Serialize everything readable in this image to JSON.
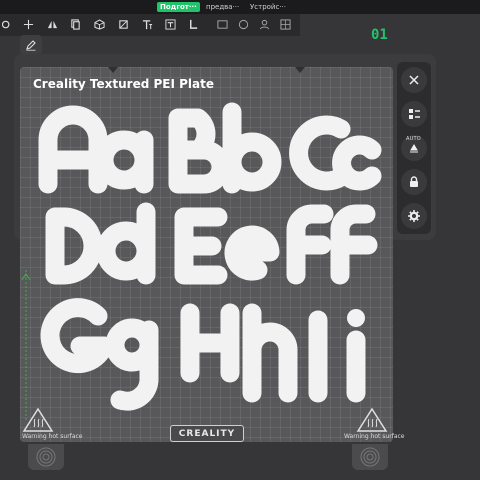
{
  "tabs": [
    {
      "label": "Подгот···",
      "active": true
    },
    {
      "label": "предва···",
      "active": false
    },
    {
      "label": "Устройс···",
      "active": false
    }
  ],
  "toolbar": {
    "icons": [
      "partial-icon",
      "move-icon",
      "mirror-icon",
      "copy-icon",
      "cube-icon",
      "box-icon",
      "text-icon",
      "text-plus-icon",
      "corner-icon",
      "corner-cut-icon",
      "image-icon",
      "sphere-icon",
      "user-icon",
      "grid-icon"
    ]
  },
  "counter": "01",
  "plate": {
    "title": "Creality Textured PEI Plate",
    "logo": "CREALITY",
    "warning": "Warning hot surface"
  },
  "sidebar": {
    "auto_label": "AUTO",
    "icons": [
      "close-icon",
      "list-icon",
      "auto-arrange-icon",
      "lock-icon",
      "gear-icon"
    ]
  },
  "colors": {
    "accent": "#1fc46a",
    "plate": "#58585b",
    "glyph": "#f2f2f2"
  }
}
